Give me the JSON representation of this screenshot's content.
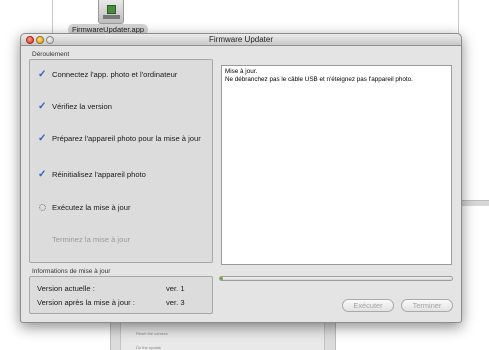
{
  "desktop": {
    "icon_label": "FirmwareUpdater.app",
    "bg_texts": [
      "Reset the camera",
      "Do the update"
    ]
  },
  "window": {
    "title": "Firmware Updater"
  },
  "steps": {
    "group_label": "Déroulement",
    "items": [
      {
        "label": "Connectez l'app. photo et l'ordinateur",
        "state": "done"
      },
      {
        "label": "Vérifiez la version",
        "state": "done"
      },
      {
        "label": "Préparez l'appareil photo pour la mise à jour",
        "state": "done"
      },
      {
        "label": "Réinitialisez l'appareil photo",
        "state": "done"
      },
      {
        "label": "Exécutez la mise à jour",
        "state": "active"
      },
      {
        "label": "Terminez la mise à jour",
        "state": "pending"
      }
    ]
  },
  "log": {
    "lines": [
      "Mise à jour.",
      "Ne débranchez pas le câble USB et n'éteignez pas l'appareil photo."
    ]
  },
  "info": {
    "group_label": "Informations de mise à jour",
    "current_version_label": "Version actuelle :",
    "current_version_value": "ver. 1",
    "after_version_label": "Version après la mise à jour :",
    "after_version_value": "ver. 3"
  },
  "progress": {
    "fraction": 0.01,
    "fill_color": "#6aa52e"
  },
  "buttons": {
    "execute_label": "Exécuter",
    "finish_label": "Terminer"
  },
  "icons": {
    "done": "checkmark-icon",
    "active": "spinner-icon"
  },
  "colors": {
    "check": "#2f62b8",
    "pending_text": "#9a9a9a"
  }
}
